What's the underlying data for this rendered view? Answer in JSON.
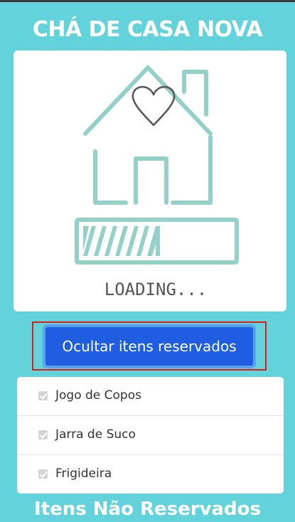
{
  "header": {
    "title": "CHÁ DE CASA NOVA"
  },
  "hero": {
    "image_icon": "house-heart-loading-illustration",
    "loading_text": "LOADING...",
    "loading_progress": 0.45,
    "colors": {
      "line": "#93d0c8",
      "heart": "#555555",
      "text": "#555555"
    }
  },
  "actions": {
    "hide_reserved_label": "Ocultar itens reservados"
  },
  "reserved_items": [
    {
      "label": "Jogo de Copos",
      "checked": true
    },
    {
      "label": "Jarra de Suco",
      "checked": true
    },
    {
      "label": "Frigideira",
      "checked": true
    }
  ],
  "next_section": {
    "heading": "Itens Não Reservados"
  },
  "colors": {
    "background": "#62d2db",
    "button": "#1f5ee0",
    "highlight_outline": "#d81e1e"
  }
}
